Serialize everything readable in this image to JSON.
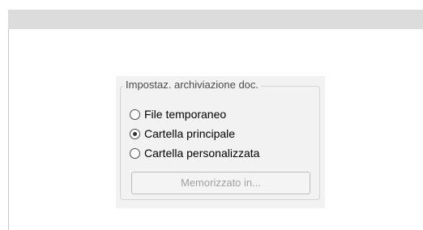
{
  "window": {
    "title": ""
  },
  "storage_group": {
    "legend": "Impostaz. archiviazione doc.",
    "options": [
      {
        "label": "File temporaneo",
        "selected": false
      },
      {
        "label": "Cartella principale",
        "selected": true
      },
      {
        "label": "Cartella personalizzata",
        "selected": false
      }
    ],
    "stored_in_button_label": "Memorizzato in..."
  },
  "colors": {
    "title_bar": "#dcdcdc",
    "dialog_background": "#f2f2f2",
    "disabled_text": "#a0a0a0"
  },
  "icons": {
    "radio_unselected": "radio-unselected-icon",
    "radio_selected": "radio-selected-icon"
  }
}
